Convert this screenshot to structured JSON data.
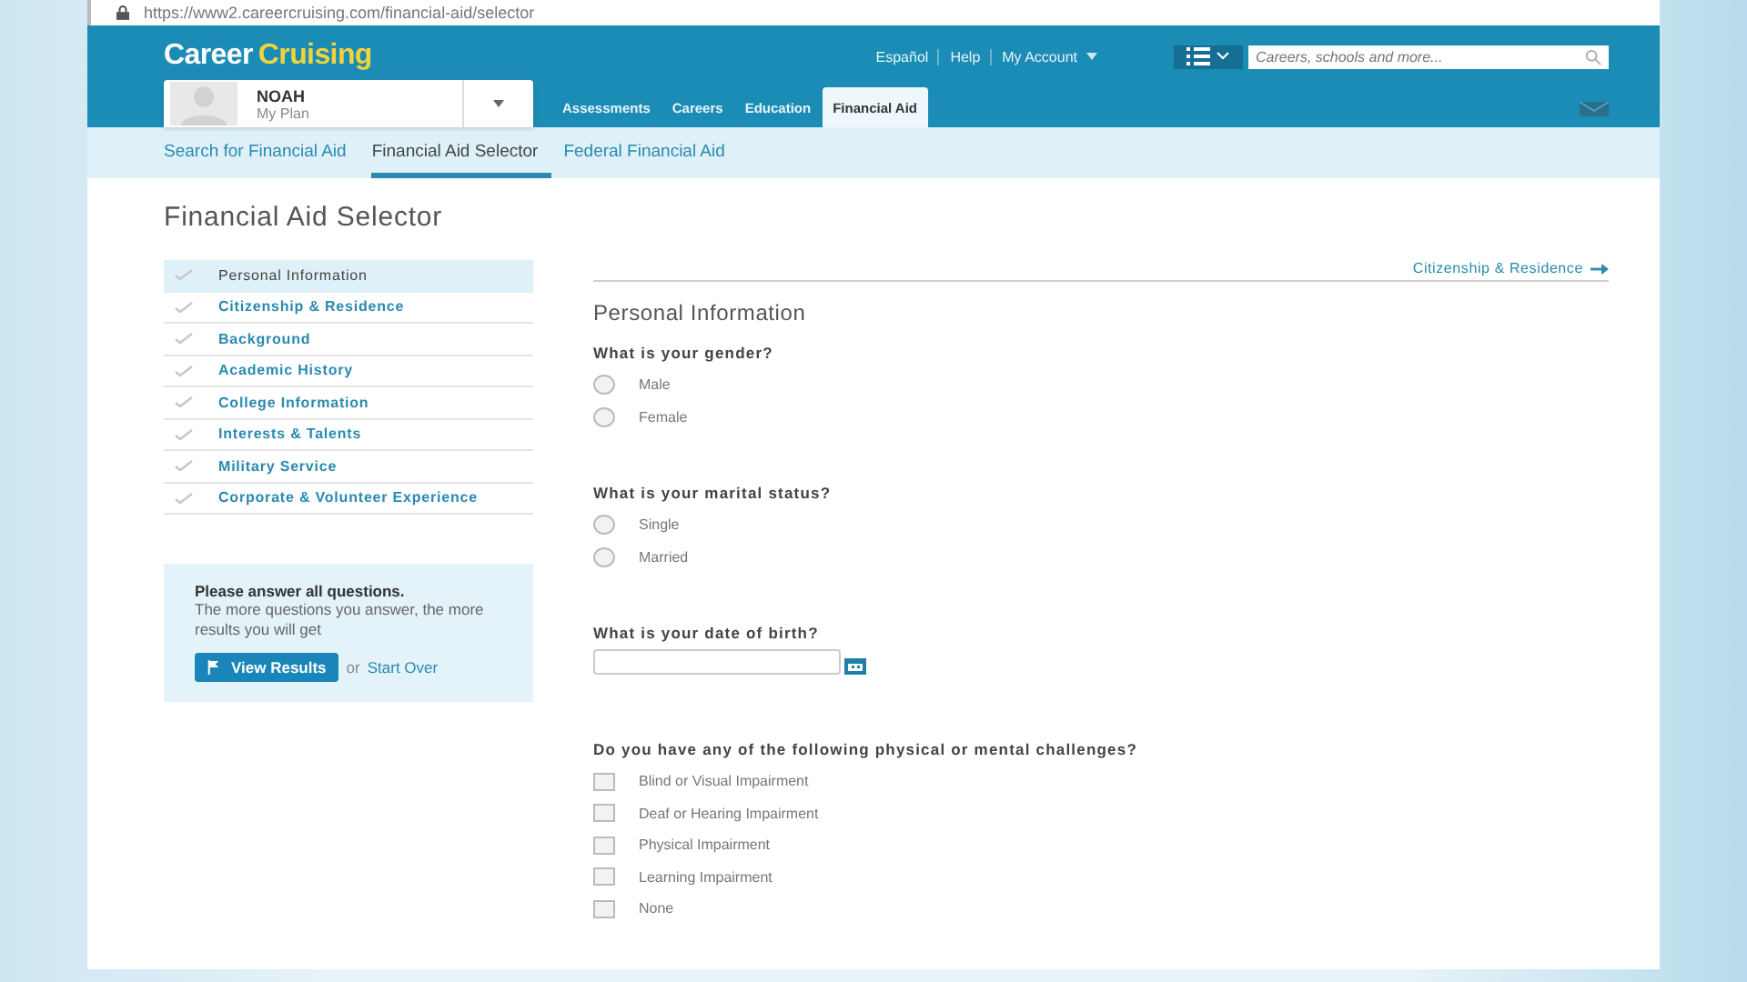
{
  "address_bar": {
    "url": "https://www2.careercruising.com/financial-aid/selector"
  },
  "header": {
    "logo": {
      "part1": "Career",
      "part2": "Cruising"
    },
    "top_links": [
      "Español",
      "Help",
      "My Account"
    ],
    "search": {
      "placeholder": "Careers, schools and more..."
    },
    "profile": {
      "name": "NOAH",
      "subtitle": "My Plan"
    },
    "nav": [
      {
        "label": "Assessments",
        "selected": false
      },
      {
        "label": "Careers",
        "selected": false
      },
      {
        "label": "Education",
        "selected": false
      },
      {
        "label": "Financial Aid",
        "selected": true
      }
    ]
  },
  "subnav": [
    {
      "label": "Search for Financial Aid",
      "selected": false
    },
    {
      "label": "Financial Aid Selector",
      "selected": true
    },
    {
      "label": "Federal Financial Aid",
      "selected": false
    }
  ],
  "page_title": "Financial Aid Selector",
  "steps": [
    {
      "label": "Personal Information",
      "selected": true
    },
    {
      "label": "Citizenship & Residence",
      "selected": false
    },
    {
      "label": "Background",
      "selected": false
    },
    {
      "label": "Academic History",
      "selected": false
    },
    {
      "label": "College Information",
      "selected": false
    },
    {
      "label": "Interests & Talents",
      "selected": false
    },
    {
      "label": "Military Service",
      "selected": false
    },
    {
      "label": "Corporate & Volunteer Experience",
      "selected": false
    }
  ],
  "info_panel": {
    "heading": "Please answer all questions.",
    "text": "The more questions you answer, the more results you will get",
    "button": "View Results",
    "or_text": "or",
    "link": "Start Over"
  },
  "next_link": "Citizenship & Residence",
  "section_title": "Personal Information",
  "questions": [
    {
      "kind": "radio",
      "text": "What is your gender?",
      "options": [
        {
          "label": "Male",
          "checked": false
        },
        {
          "label": "Female",
          "checked": false
        }
      ]
    },
    {
      "kind": "radio",
      "text": "What is your marital status?",
      "options": [
        {
          "label": "Single",
          "checked": false
        },
        {
          "label": "Married",
          "checked": false
        }
      ]
    },
    {
      "kind": "date",
      "text": "What is your date of birth?"
    },
    {
      "kind": "checkbox",
      "text": "Do you have any of the following physical or mental challenges?",
      "options": [
        {
          "label": "Blind or Visual Impairment",
          "checked": false
        },
        {
          "label": "Deaf or Hearing Impairment",
          "checked": false
        },
        {
          "label": "Physical Impairment",
          "checked": false
        },
        {
          "label": "Learning Impairment",
          "checked": false
        },
        {
          "label": "None",
          "checked": false
        }
      ]
    }
  ]
}
